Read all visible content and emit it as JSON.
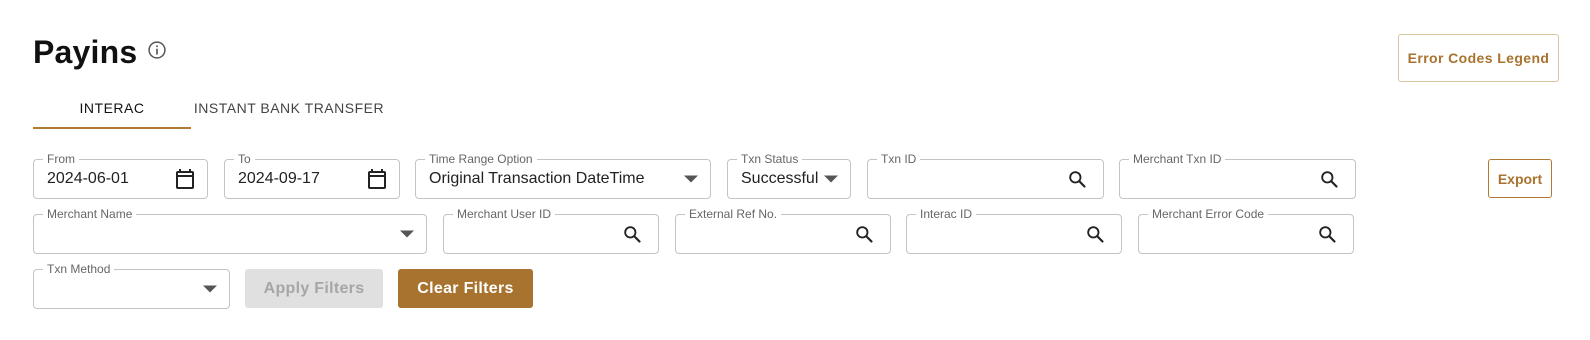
{
  "header": {
    "title": "Payins",
    "error_codes_legend_label": "Error Codes Legend"
  },
  "tabs": [
    {
      "label": "INTERAC",
      "active": true
    },
    {
      "label": "INSTANT BANK TRANSFER",
      "active": false
    }
  ],
  "filters": {
    "from": {
      "label": "From",
      "value": "2024-06-01"
    },
    "to": {
      "label": "To",
      "value": "2024-09-17"
    },
    "time_range_option": {
      "label": "Time Range Option",
      "value": "Original Transaction DateTime"
    },
    "txn_status": {
      "label": "Txn Status",
      "value": "Successful"
    },
    "txn_id": {
      "label": "Txn ID",
      "value": ""
    },
    "merchant_txn_id": {
      "label": "Merchant Txn ID",
      "value": ""
    },
    "merchant_name": {
      "label": "Merchant Name",
      "value": ""
    },
    "merchant_user_id": {
      "label": "Merchant User ID",
      "value": ""
    },
    "external_ref_no": {
      "label": "External Ref No.",
      "value": ""
    },
    "interac_id": {
      "label": "Interac ID",
      "value": ""
    },
    "merchant_error_code": {
      "label": "Merchant Error Code",
      "value": ""
    },
    "txn_method": {
      "label": "Txn Method",
      "value": ""
    }
  },
  "actions": {
    "export_label": "Export",
    "apply_filters_label": "Apply Filters",
    "clear_filters_label": "Clear Filters"
  },
  "colors": {
    "accent": "#a8732e",
    "disabled_bg": "#e0e0e0",
    "disabled_text": "#a6a6a6",
    "border": "#c4c4c4"
  },
  "icons": {
    "info": "info-circle-icon",
    "calendar": "calendar-icon",
    "search": "search-icon",
    "dropdown": "caret-down-icon"
  }
}
